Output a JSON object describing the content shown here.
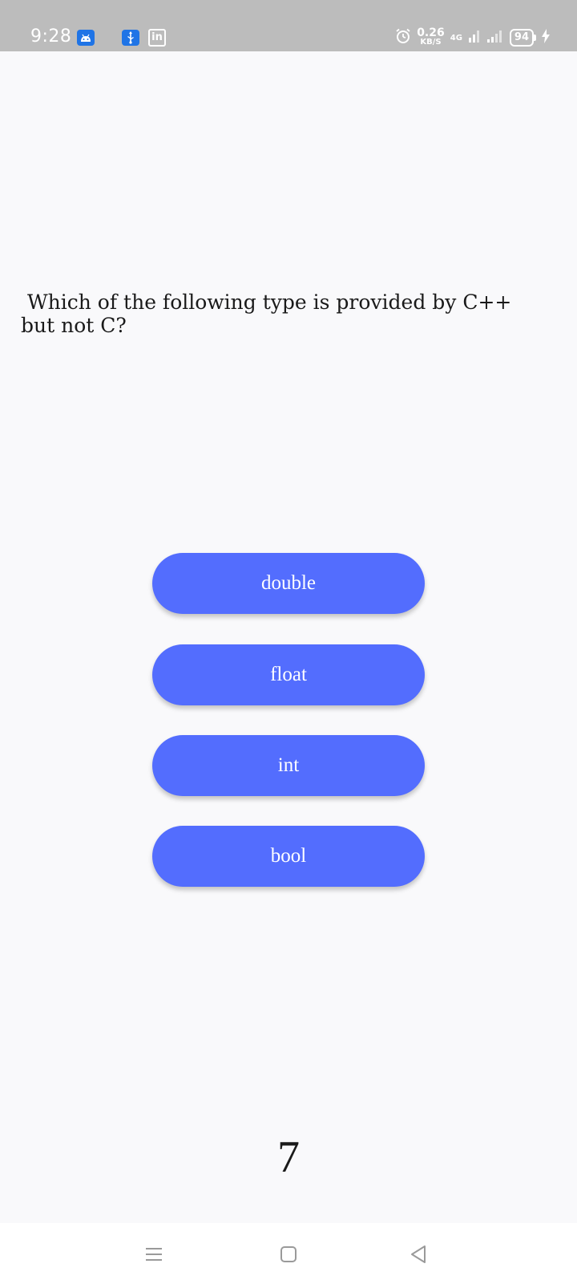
{
  "status_bar": {
    "time": "9:28",
    "speed_value": "0.26",
    "speed_unit": "KB/S",
    "network_type": "4G",
    "battery": "94",
    "icons": [
      "android-notification-icon",
      "usb-notification-icon",
      "linkedin-icon",
      "alarm-icon",
      "signal-icon",
      "signal-icon",
      "battery-icon",
      "charging-icon"
    ]
  },
  "quiz": {
    "question": " Which of the following type is provided by C++\nbut not C?",
    "options": [
      "double",
      "float",
      "int",
      "bool"
    ],
    "counter": "7"
  },
  "colors": {
    "accent": "#536dfe",
    "status_bar": "#bcbcbc",
    "background": "#f9f9fb"
  },
  "nav_bar": {
    "icons": [
      "menu-icon",
      "home-icon",
      "back-icon"
    ]
  }
}
